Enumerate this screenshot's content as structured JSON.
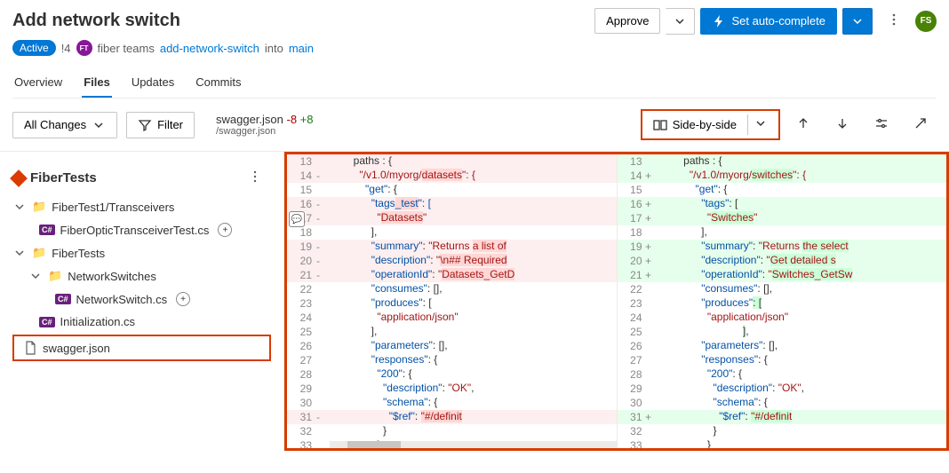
{
  "title": "Add network switch",
  "badge": "Active",
  "prNum": "!4",
  "teamAv": "FT",
  "teamName": "fiber teams",
  "branch": "add-network-switch",
  "into": "into",
  "target": "main",
  "approve": "Approve",
  "autocomplete": "Set auto-complete",
  "userAv": "FS",
  "tabs": {
    "overview": "Overview",
    "files": "Files",
    "updates": "Updates",
    "commits": "Commits"
  },
  "allChanges": "All Changes",
  "filter": "Filter",
  "file": {
    "name": "swagger.json",
    "removed": "-8",
    "added": "+8",
    "path": "/swagger.json"
  },
  "sbs": "Side-by-side",
  "tree": {
    "root": "FiberTests",
    "n1": "FiberTest1/Transceivers",
    "n1a": "FiberOpticTransceiverTest.cs",
    "n2": "FiberTests",
    "n3": "NetworkSwitches",
    "n3a": "NetworkSwitch.cs",
    "n2a": "Initialization.cs",
    "sel": "swagger.json"
  },
  "left": [
    {
      "n": "13",
      "t": "        paths : {",
      "c": "rem"
    },
    {
      "n": "14",
      "s": "-",
      "t": "          \"/v1.0/myorg/datasets\": {",
      "c": "rem",
      "hl": [
        [
          "\"/v1.0/myorg/",
          "s"
        ],
        [
          "datasets",
          "s rem-s"
        ],
        [
          "\": {",
          "s"
        ]
      ]
    },
    {
      "n": "15",
      "t": "            \"get\": {",
      "hl": [
        [
          "\"get\"",
          "k"
        ],
        [
          ": {",
          ""
        ]
      ]
    },
    {
      "n": "16",
      "s": "-",
      "t": "              \"tags_test\": [",
      "c": "rem",
      "hl": [
        [
          "\"tags",
          "k"
        ],
        [
          "_test",
          "k rem-s"
        ],
        [
          "\": [",
          "k"
        ]
      ]
    },
    {
      "n": "17",
      "s": "-",
      "t": "                \"Datasets\"",
      "c": "rem",
      "hl": [
        [
          "\"",
          "s"
        ],
        [
          "Datasets",
          "s rem-s"
        ],
        [
          "\"",
          "s"
        ]
      ]
    },
    {
      "n": "18",
      "t": "              ],"
    },
    {
      "n": "19",
      "s": "-",
      "t": "              \"summary\": \"Returns a list of",
      "c": "rem",
      "hl": [
        [
          "\"summary\"",
          "k"
        ],
        [
          ": ",
          ""
        ],
        [
          "\"Returns ",
          "s"
        ],
        [
          "a list of",
          "s rem-s"
        ]
      ]
    },
    {
      "n": "20",
      "s": "-",
      "t": "              \"description\": \"\\n## Required",
      "c": "rem",
      "hl": [
        [
          "\"description\"",
          "k"
        ],
        [
          ": ",
          ""
        ],
        [
          "\"",
          "s"
        ],
        [
          "\\n## Required",
          "s rem-s"
        ]
      ]
    },
    {
      "n": "21",
      "s": "-",
      "t": "              \"operationId\": \"Datasets_GetD",
      "c": "rem",
      "hl": [
        [
          "\"operationId\"",
          "k"
        ],
        [
          ": ",
          ""
        ],
        [
          "\"",
          "s"
        ],
        [
          "Datasets_GetD",
          "s rem-s"
        ]
      ]
    },
    {
      "n": "22",
      "t": "              \"consumes\": [],",
      "hl": [
        [
          "\"consumes\"",
          "k"
        ],
        [
          ": [],",
          ""
        ]
      ]
    },
    {
      "n": "23",
      "t": "              \"produces\": [",
      "hl": [
        [
          "\"produces\"",
          "k"
        ],
        [
          ": [",
          ""
        ]
      ]
    },
    {
      "n": "24",
      "t": "                \"application/json\"",
      "hl": [
        [
          "\"application/json\"",
          "s"
        ]
      ]
    },
    {
      "n": "25",
      "t": "              ],"
    },
    {
      "n": "26",
      "t": "              \"parameters\": [],",
      "hl": [
        [
          "\"parameters\"",
          "k"
        ],
        [
          ": [],",
          ""
        ]
      ]
    },
    {
      "n": "27",
      "t": "              \"responses\": {",
      "hl": [
        [
          "\"responses\"",
          "k"
        ],
        [
          ": {",
          ""
        ]
      ]
    },
    {
      "n": "28",
      "t": "                \"200\": {",
      "hl": [
        [
          "\"200\"",
          "k"
        ],
        [
          ": {",
          ""
        ]
      ]
    },
    {
      "n": "29",
      "t": "                  \"description\": \"OK\",",
      "hl": [
        [
          "\"description\"",
          "k"
        ],
        [
          ": ",
          ""
        ],
        [
          "\"OK\"",
          "s"
        ],
        [
          ",",
          ""
        ]
      ]
    },
    {
      "n": "30",
      "t": "                  \"schema\": {",
      "hl": [
        [
          "\"schema\"",
          "k"
        ],
        [
          ": {",
          ""
        ]
      ]
    },
    {
      "n": "31",
      "s": "-",
      "t": "                    \"$ref\": \"#/definit",
      "c": "rem",
      "hl": [
        [
          "\"$ref\"",
          "k"
        ],
        [
          ": ",
          ""
        ],
        [
          "\"#/definit",
          "s rem-s"
        ]
      ]
    },
    {
      "n": "32",
      "t": "                  }"
    },
    {
      "n": "33",
      "t": "                }"
    }
  ],
  "right": [
    {
      "n": "13",
      "t": "        paths : {",
      "c": "add"
    },
    {
      "n": "14",
      "s": "+",
      "t": "          \"/v1.0/myorg/switches\": {",
      "c": "add",
      "hl": [
        [
          "\"/v1.0/myorg/",
          "s"
        ],
        [
          "switches",
          "s add-s"
        ],
        [
          "\": {",
          "s"
        ]
      ]
    },
    {
      "n": "15",
      "t": "            \"get\": {",
      "hl": [
        [
          "\"get\"",
          "k"
        ],
        [
          ": {",
          ""
        ]
      ]
    },
    {
      "n": "16",
      "s": "+",
      "t": "              \"tags\": [",
      "c": "add",
      "hl": [
        [
          "\"tags\"",
          "k"
        ],
        [
          ": [",
          ""
        ]
      ]
    },
    {
      "n": "17",
      "s": "+",
      "t": "                \"Switches\"",
      "c": "add",
      "hl": [
        [
          "\"",
          "s"
        ],
        [
          "Switches",
          "s add-s"
        ],
        [
          "\"",
          "s"
        ]
      ]
    },
    {
      "n": "18",
      "t": "              ],"
    },
    {
      "n": "19",
      "s": "+",
      "t": "              \"summary\": \"Returns the select",
      "c": "add",
      "hl": [
        [
          "\"summary\"",
          "k"
        ],
        [
          ": ",
          ""
        ],
        [
          "\"Returns ",
          "s"
        ],
        [
          "the select",
          "s add-s"
        ]
      ]
    },
    {
      "n": "20",
      "s": "+",
      "t": "              \"description\": \"Get detailed s",
      "c": "add",
      "hl": [
        [
          "\"description\"",
          "k"
        ],
        [
          ": ",
          ""
        ],
        [
          "\"",
          "s"
        ],
        [
          "Get detailed s",
          "s add-s"
        ]
      ]
    },
    {
      "n": "21",
      "s": "+",
      "t": "              \"operationId\": \"Switches_GetSw",
      "c": "add",
      "hl": [
        [
          "\"operationId\"",
          "k"
        ],
        [
          ": ",
          ""
        ],
        [
          "\"",
          "s"
        ],
        [
          "Switches_GetSw",
          "s add-s"
        ]
      ]
    },
    {
      "n": "22",
      "t": "              \"consumes\": [],",
      "hl": [
        [
          "\"consumes\"",
          "k"
        ],
        [
          ": [],",
          ""
        ]
      ]
    },
    {
      "n": "23",
      "t": "              \"produces\": [",
      "hl": [
        [
          "\"produces\"",
          "k"
        ],
        [
          ": ",
          "add-s"
        ],
        [
          "[",
          "add-s"
        ]
      ]
    },
    {
      "n": "24",
      "t": "                \"application/json\"",
      "hl": [
        [
          "\"application/json\"",
          "s"
        ]
      ]
    },
    {
      "n": "25",
      "t": "              ],",
      "hl": [
        [
          "              ",
          ""
        ],
        [
          "]",
          "add-s"
        ],
        [
          ",",
          ""
        ]
      ]
    },
    {
      "n": "26",
      "t": "              \"parameters\": [],",
      "hl": [
        [
          "\"parameters\"",
          "k"
        ],
        [
          ": [],",
          ""
        ]
      ]
    },
    {
      "n": "27",
      "t": "              \"responses\": {",
      "hl": [
        [
          "\"responses\"",
          "k"
        ],
        [
          ": {",
          ""
        ]
      ]
    },
    {
      "n": "28",
      "t": "                \"200\": {",
      "hl": [
        [
          "\"200\"",
          "k"
        ],
        [
          ": {",
          ""
        ]
      ]
    },
    {
      "n": "29",
      "t": "                  \"description\": \"OK\",",
      "hl": [
        [
          "\"description\"",
          "k"
        ],
        [
          ": ",
          ""
        ],
        [
          "\"OK\"",
          "s"
        ],
        [
          ",",
          ""
        ]
      ]
    },
    {
      "n": "30",
      "t": "                  \"schema\": {",
      "hl": [
        [
          "\"schema\"",
          "k"
        ],
        [
          ": {",
          ""
        ]
      ]
    },
    {
      "n": "31",
      "s": "+",
      "t": "                    \"$ref\": \"#/definit",
      "c": "add",
      "hl": [
        [
          "\"$ref\"",
          "k"
        ],
        [
          ": ",
          ""
        ],
        [
          "\"#/definit",
          "s add-s"
        ]
      ]
    },
    {
      "n": "32",
      "t": "                  }"
    },
    {
      "n": "33",
      "t": "                }"
    }
  ]
}
